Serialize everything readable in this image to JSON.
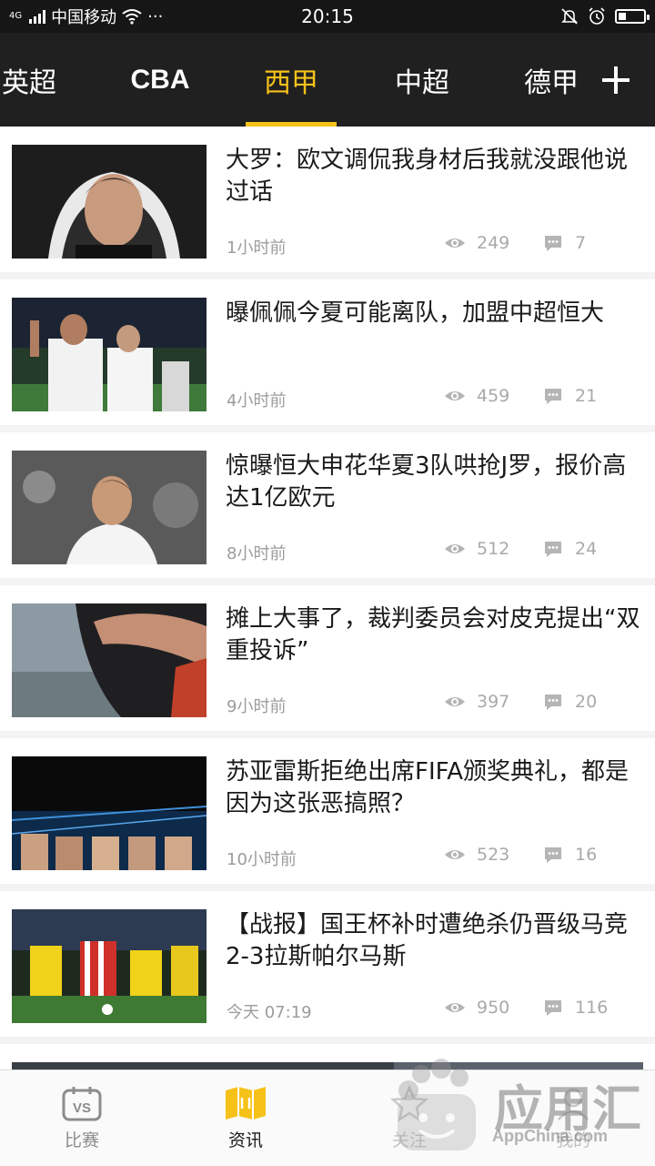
{
  "status_bar": {
    "network": "4G",
    "carrier": "中国移动",
    "more": "···",
    "time": "20:15"
  },
  "tabs": [
    {
      "label": "英超",
      "active": false
    },
    {
      "label": "CBA",
      "active": false
    },
    {
      "label": "西甲",
      "active": true
    },
    {
      "label": "中超",
      "active": false
    },
    {
      "label": "德甲",
      "active": false
    }
  ],
  "add_tab_icon": "plus-icon",
  "news": [
    {
      "title": "大罗：欧文调侃我身材后我就没跟他说过话",
      "time": "1小时前",
      "views": "249",
      "comments": "7"
    },
    {
      "title": "曝佩佩今夏可能离队，加盟中超恒大",
      "time": "4小时前",
      "views": "459",
      "comments": "21"
    },
    {
      "title": "惊曝恒大申花华夏3队哄抢J罗，报价高达1亿欧元",
      "time": "8小时前",
      "views": "512",
      "comments": "24"
    },
    {
      "title": "摊上大事了，裁判委员会对皮克提出“双重投诉”",
      "time": "9小时前",
      "views": "397",
      "comments": "20"
    },
    {
      "title": "苏亚雷斯拒绝出席FIFA颁奖典礼，都是因为这张恶搞照？",
      "time": "10小时前",
      "views": "523",
      "comments": "16"
    },
    {
      "title": "【战报】国王杯补时遭绝杀仍晋级马竞2-3拉斯帕尔马斯",
      "time": "今天 07:19",
      "views": "950",
      "comments": "116"
    }
  ],
  "bottom_nav": [
    {
      "label": "比赛",
      "icon": "vs-calendar-icon",
      "active": false
    },
    {
      "label": "资讯",
      "icon": "news-book-icon",
      "active": true
    },
    {
      "label": "关注",
      "icon": "star-icon",
      "active": false
    },
    {
      "label": "我的",
      "icon": "user-icon",
      "active": false
    }
  ],
  "watermark": {
    "text": "应用汇",
    "sub": "AppChina.com"
  },
  "colors": {
    "accent": "#f6c21a",
    "tab_bar": "#202020",
    "status_bar": "#161616"
  }
}
